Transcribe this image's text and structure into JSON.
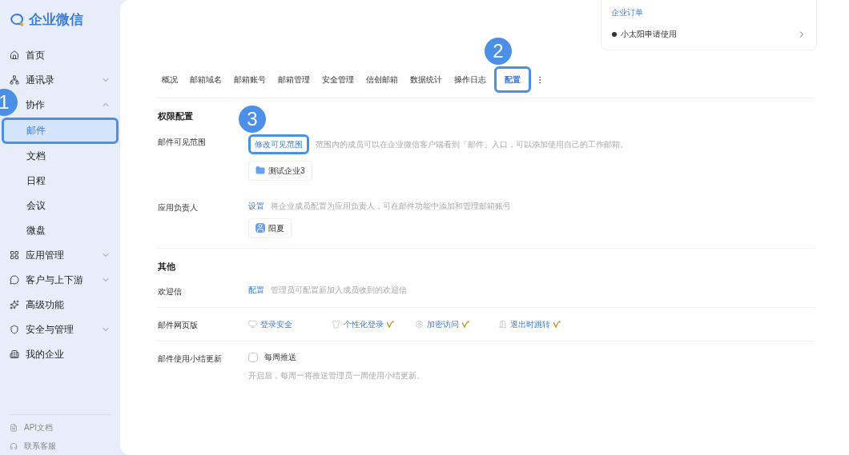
{
  "logo": {
    "name": "企业微信"
  },
  "sidebar": {
    "items": [
      {
        "label": "首页"
      },
      {
        "label": "通讯录",
        "expanded": false
      },
      {
        "label": "协作",
        "expanded": true,
        "children": [
          {
            "label": "邮件",
            "selected": true,
            "callout": "1"
          },
          {
            "label": "文档",
            "selected": false
          },
          {
            "label": "日程",
            "selected": false
          },
          {
            "label": "会议",
            "selected": false
          },
          {
            "label": "微盘",
            "selected": false
          }
        ]
      },
      {
        "label": "应用管理",
        "expanded": false
      },
      {
        "label": "客户与上下游",
        "expanded": false
      },
      {
        "label": "高级功能"
      },
      {
        "label": "安全与管理",
        "expanded": false
      },
      {
        "label": "我的企业"
      }
    ],
    "footer": [
      {
        "label": "API文档"
      },
      {
        "label": "联系客服"
      }
    ]
  },
  "order_card": {
    "title": "企业订单",
    "item": "小太阳申请使用"
  },
  "tabs": [
    {
      "label": "概况",
      "selected": false
    },
    {
      "label": "邮箱域名",
      "selected": false
    },
    {
      "label": "邮箱账号",
      "selected": false
    },
    {
      "label": "邮箱管理",
      "selected": false
    },
    {
      "label": "安全管理",
      "selected": false
    },
    {
      "label": "信创邮箱",
      "selected": false
    },
    {
      "label": "数据统计",
      "selected": false
    },
    {
      "label": "操作日志",
      "selected": false
    },
    {
      "label": "配置",
      "selected": true,
      "callout": "2"
    }
  ],
  "sections": [
    {
      "title": "权限配置",
      "rows": [
        {
          "kind": "link",
          "label": "邮件可见范围",
          "link": "修改可见范围",
          "callout": "3",
          "hint": "范围内的成员可以在企业微信客户端看到「邮件」入口，可以添加使用自己的工作邮箱。",
          "chip": {
            "kind": "group",
            "text": "测试企业3"
          }
        },
        {
          "kind": "link",
          "label": "应用负责人",
          "link": "设置",
          "hint": "将企业成员配置为应用负责人，可在邮件功能中添加和管理邮箱账号",
          "chip": {
            "kind": "person",
            "text": "阳夏"
          }
        }
      ]
    },
    {
      "title": "其他",
      "rows": [
        {
          "kind": "link",
          "label": "欢迎信",
          "link": "配置",
          "hint": "管理员可配置新加入成员收到的欢迎信"
        },
        {
          "kind": "features",
          "label": "邮件网页版",
          "features": [
            {
              "text": "登录安全",
              "premium": false
            },
            {
              "text": "个性化登录",
              "premium": true
            },
            {
              "text": "加密访问",
              "premium": true
            },
            {
              "text": "退出时跳转",
              "premium": true
            }
          ]
        },
        {
          "kind": "checkbox",
          "label": "邮件使用小结更新",
          "option": "每周推送",
          "checked": false,
          "hint": "开启后，每周一将推送管理员一周使用小结更新。"
        }
      ]
    }
  ]
}
